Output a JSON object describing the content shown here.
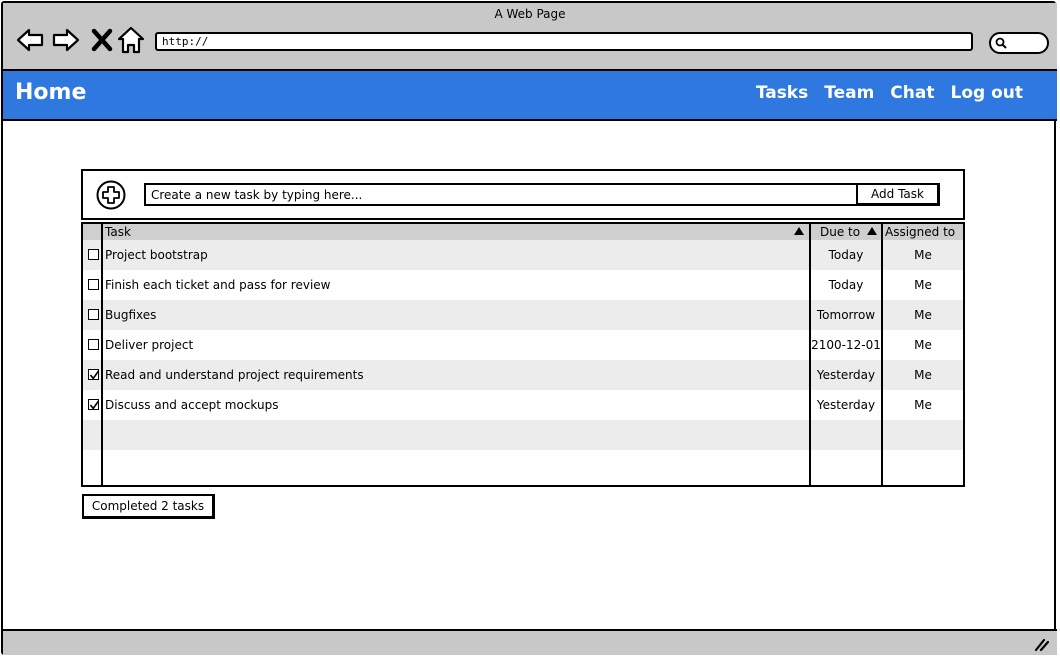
{
  "window": {
    "title": "A Web Page",
    "url": "http://"
  },
  "header": {
    "brand": "Home",
    "nav": [
      "Tasks",
      "Team",
      "Chat",
      "Log out"
    ],
    "color": "#2f78e0"
  },
  "add_task": {
    "placeholder": "Create a new task by typing here...",
    "button_label": "Add Task"
  },
  "table": {
    "columns": {
      "task": "Task",
      "due": "Due to",
      "assigned": "Assigned to"
    },
    "rows": [
      {
        "checked": false,
        "task": "Project bootstrap",
        "due": "Today",
        "assigned": "Me"
      },
      {
        "checked": false,
        "task": "Finish each ticket and pass for review",
        "due": "Today",
        "assigned": "Me"
      },
      {
        "checked": false,
        "task": "Bugfixes",
        "due": "Tomorrow",
        "assigned": "Me"
      },
      {
        "checked": false,
        "task": "Deliver project",
        "due": "2100-12-01",
        "assigned": "Me"
      },
      {
        "checked": true,
        "task": "Read and understand project requirements",
        "due": "Yesterday",
        "assigned": "Me"
      },
      {
        "checked": true,
        "task": "Discuss and accept mockups",
        "due": "Yesterday",
        "assigned": "Me"
      }
    ]
  },
  "footer": {
    "completed_label": "Completed 2 tasks"
  }
}
